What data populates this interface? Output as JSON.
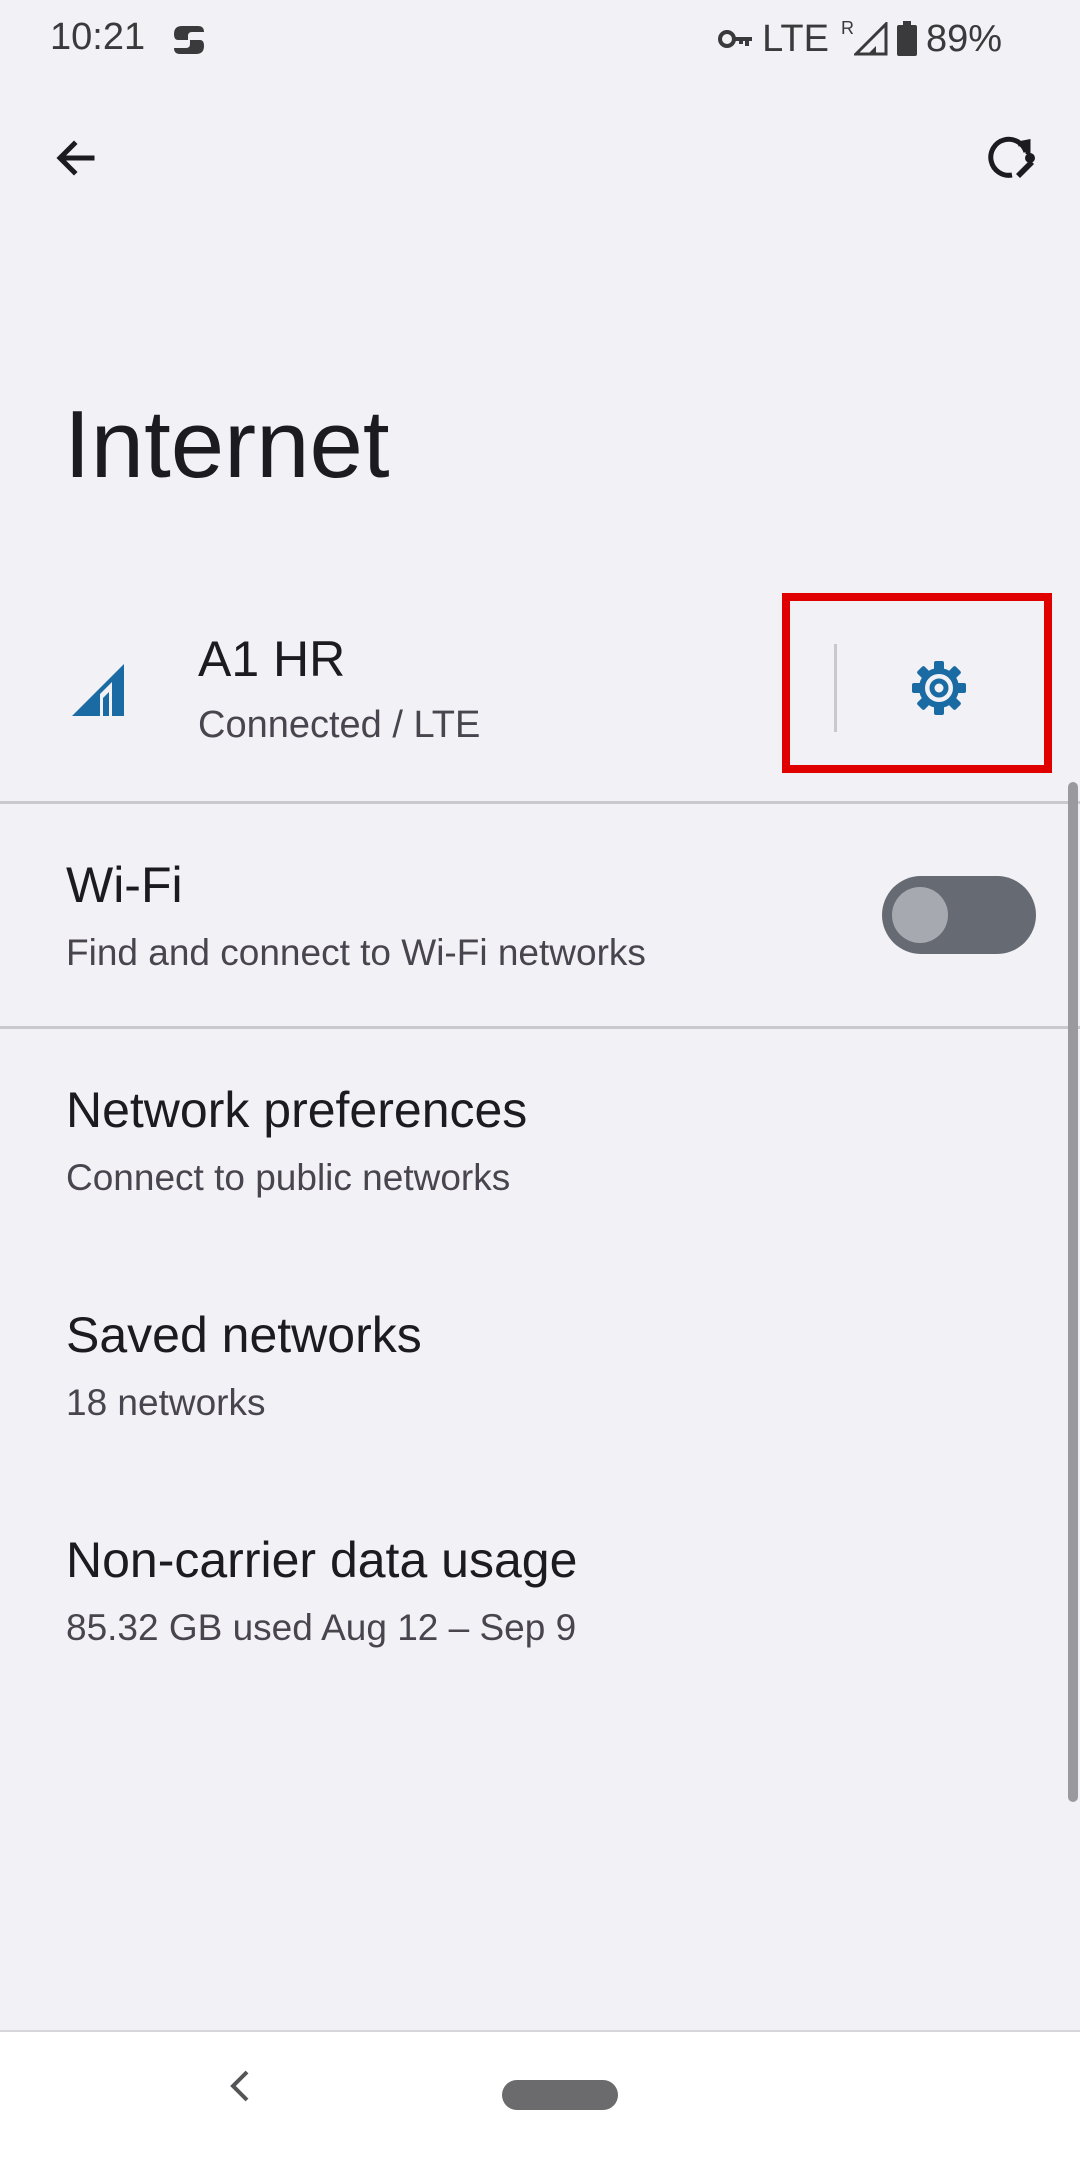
{
  "status_bar": {
    "time": "10:21",
    "network": "LTE",
    "roaming_indicator": "R",
    "battery": "89%",
    "icons": [
      "app-notification-icon",
      "vpn-key-icon",
      "signal-icon",
      "battery-icon"
    ]
  },
  "top_bar": {
    "back_icon": "arrow-back-icon",
    "diagnostics_icon": "network-refresh-icon"
  },
  "page": {
    "title": "Internet"
  },
  "carrier": {
    "name": "A1 HR",
    "status": "Connected / LTE",
    "settings_icon": "gear-icon"
  },
  "wifi": {
    "title": "Wi-Fi",
    "subtitle": "Find and connect to Wi-Fi networks",
    "enabled": false
  },
  "list": [
    {
      "title": "Network preferences",
      "subtitle": "Connect to public networks"
    },
    {
      "title": "Saved networks",
      "subtitle": "18 networks"
    },
    {
      "title": "Non-carrier data usage",
      "subtitle": "85.32 GB used Aug 12 – Sep 9"
    }
  ],
  "colors": {
    "background": "#f2f1f6",
    "accent": "#1a6aa3",
    "highlight": "#e00000",
    "toggle_track_off": "#666a72"
  },
  "nav_bar": {
    "back_icon": "chevron-left-icon",
    "home_icon": "home-pill-icon"
  }
}
